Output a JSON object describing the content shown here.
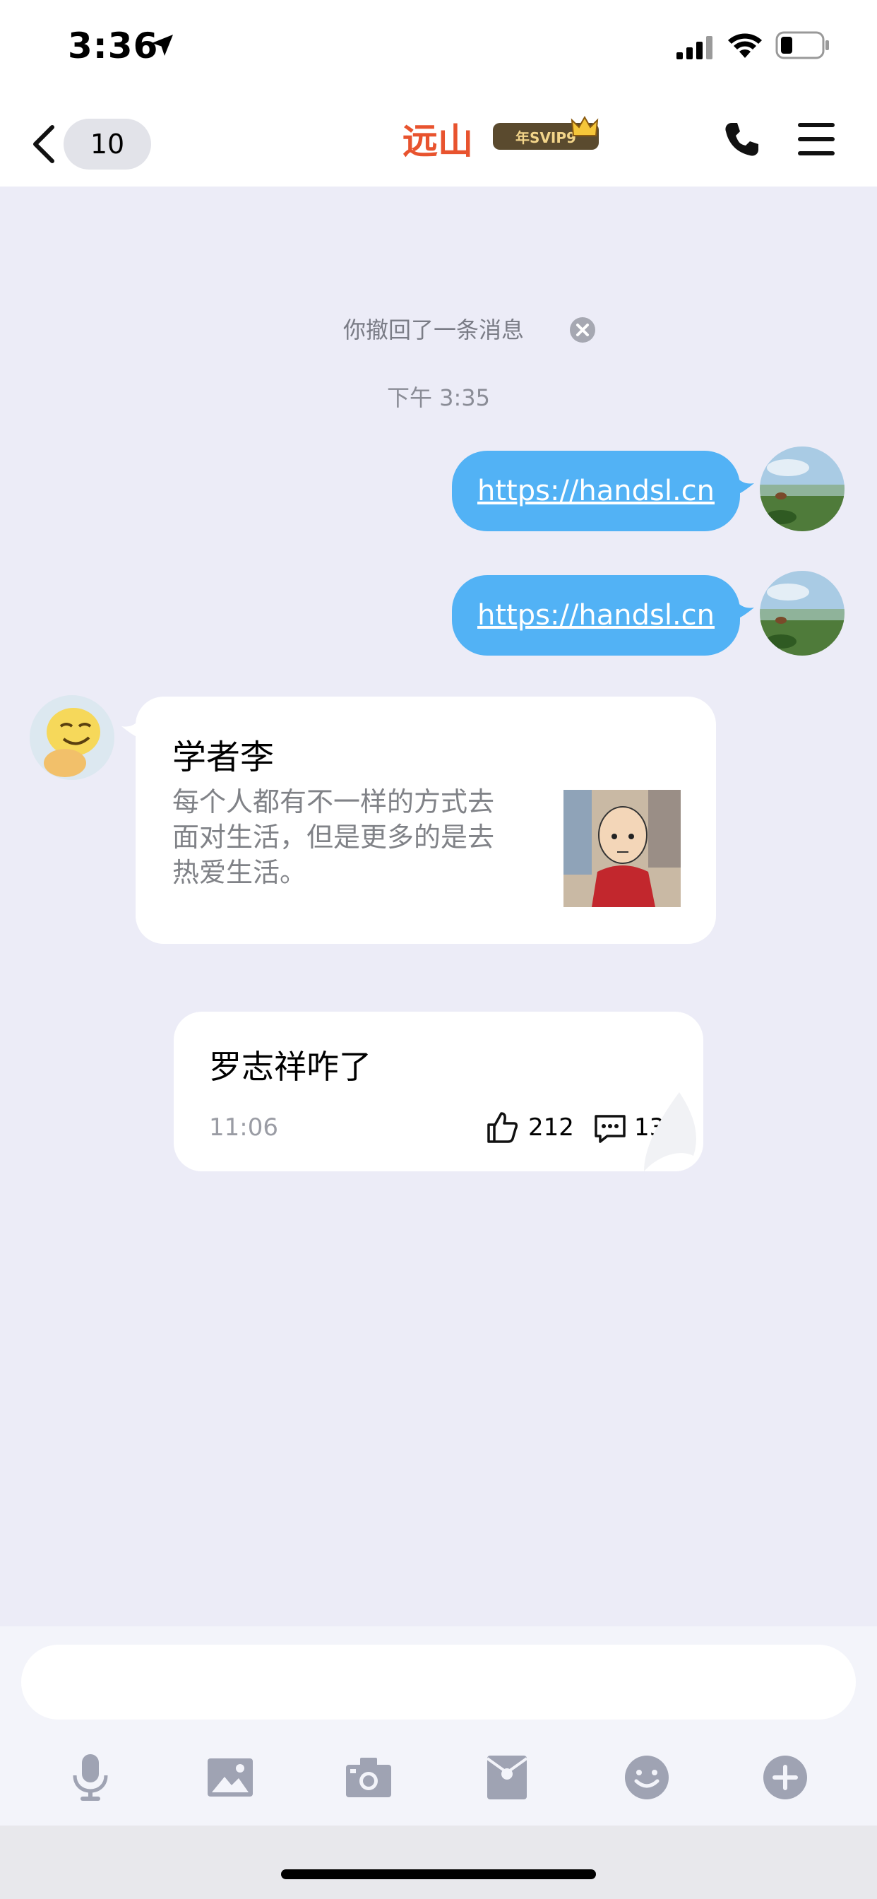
{
  "status_bar": {
    "time": "3:36"
  },
  "nav": {
    "back_count": "10",
    "title": "远山",
    "vip_badge": "年SVIP9"
  },
  "chat": {
    "recall_notice": "你撤回了一条消息",
    "time_label": "下午 3:35",
    "outgoing_messages": [
      {
        "text": "https://handsl.cn"
      },
      {
        "text": "https://handsl.cn"
      }
    ],
    "share_card": {
      "title": "学者李",
      "description": "每个人都有不一样的方式去面对生活，但是更多的是去热爱生活。"
    },
    "post_card": {
      "text": "罗志祥咋了",
      "time": "11:06",
      "likes": "212",
      "comments": "13"
    }
  },
  "input": {
    "placeholder": ""
  },
  "toolbar": {
    "items": [
      "mic-icon",
      "image-icon",
      "camera-icon",
      "red-packet-icon",
      "emoji-icon",
      "plus-icon"
    ]
  },
  "colors": {
    "title": "#E8532E",
    "bubble_out": "#52B2F5",
    "background": "#ECECF7"
  }
}
